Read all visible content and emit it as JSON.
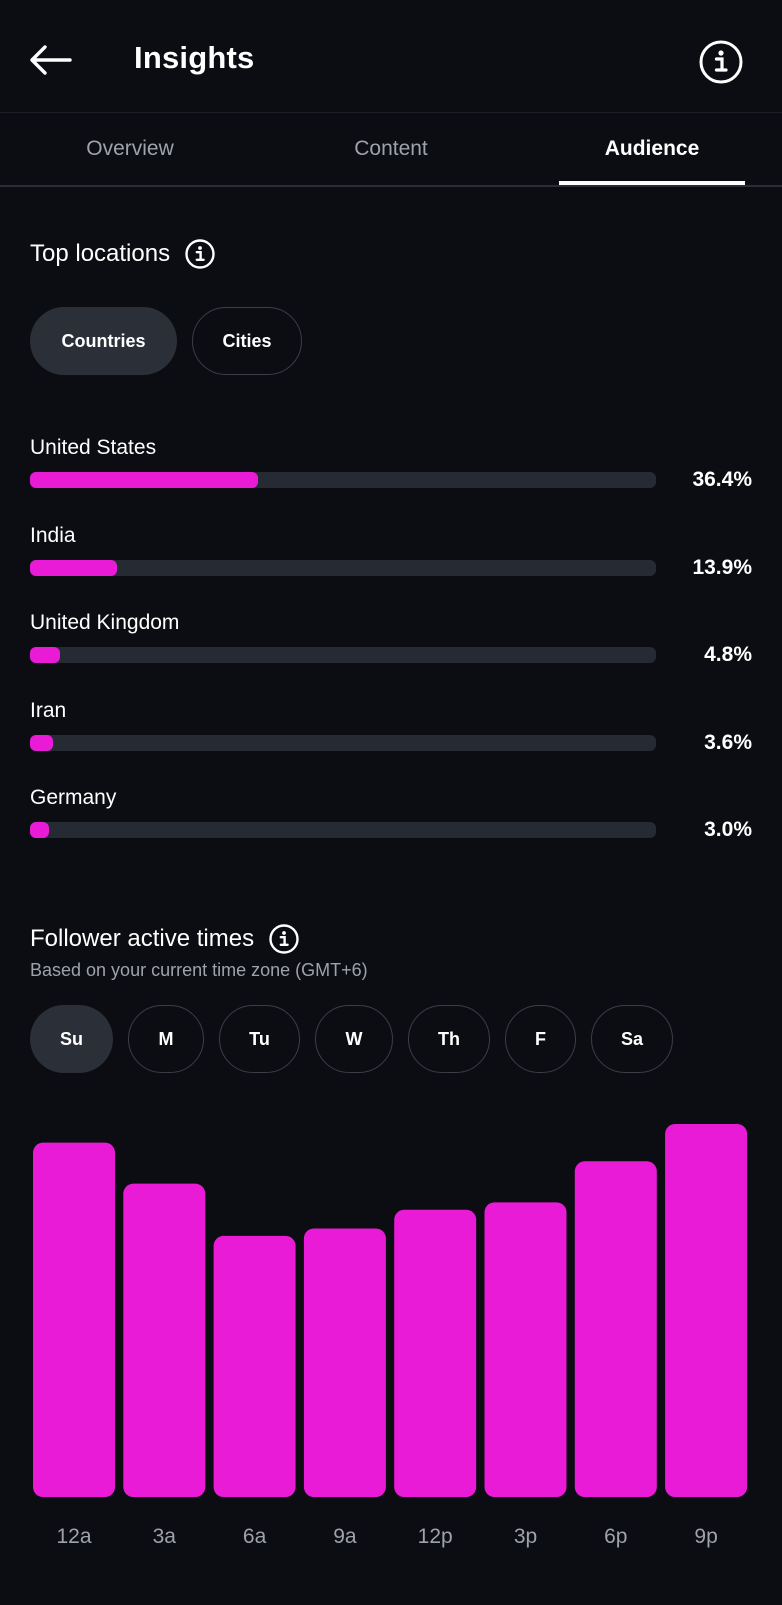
{
  "header": {
    "title": "Insights",
    "back_icon": "arrow-left-icon",
    "info_icon": "info-circle-icon"
  },
  "tabs": [
    {
      "label": "Overview",
      "active": false
    },
    {
      "label": "Content",
      "active": false
    },
    {
      "label": "Audience",
      "active": true
    }
  ],
  "top_locations": {
    "title": "Top locations",
    "filters": [
      {
        "label": "Countries",
        "selected": true
      },
      {
        "label": "Cities",
        "selected": false
      }
    ],
    "items": [
      {
        "name": "United States",
        "value": "36.4%",
        "fraction": 0.364
      },
      {
        "name": "India",
        "value": "13.9%",
        "fraction": 0.139
      },
      {
        "name": "United Kingdom",
        "value": "4.8%",
        "fraction": 0.048
      },
      {
        "name": "Iran",
        "value": "3.6%",
        "fraction": 0.036
      },
      {
        "name": "Germany",
        "value": "3.0%",
        "fraction": 0.03
      }
    ]
  },
  "active_times": {
    "title": "Follower active times",
    "subtitle": "Based on your current time zone (GMT+6)",
    "days": [
      {
        "label": "Su",
        "selected": true
      },
      {
        "label": "M",
        "selected": false
      },
      {
        "label": "Tu",
        "selected": false
      },
      {
        "label": "W",
        "selected": false
      },
      {
        "label": "Th",
        "selected": false
      },
      {
        "label": "F",
        "selected": false
      },
      {
        "label": "Sa",
        "selected": false
      }
    ]
  },
  "colors": {
    "accent": "#ea1bd7",
    "background": "#0b0d12",
    "track": "#262a33",
    "muted_text": "#9ea2ab"
  },
  "chart_data": {
    "type": "bar",
    "categories": [
      "12a",
      "3a",
      "6a",
      "9a",
      "12p",
      "3p",
      "6p",
      "9p"
    ],
    "values": [
      95,
      84,
      70,
      72,
      77,
      79,
      90,
      100
    ],
    "title": "",
    "xlabel": "",
    "ylabel": "",
    "ylim": [
      0,
      100
    ],
    "grid": false,
    "color": "#ea1bd7"
  }
}
